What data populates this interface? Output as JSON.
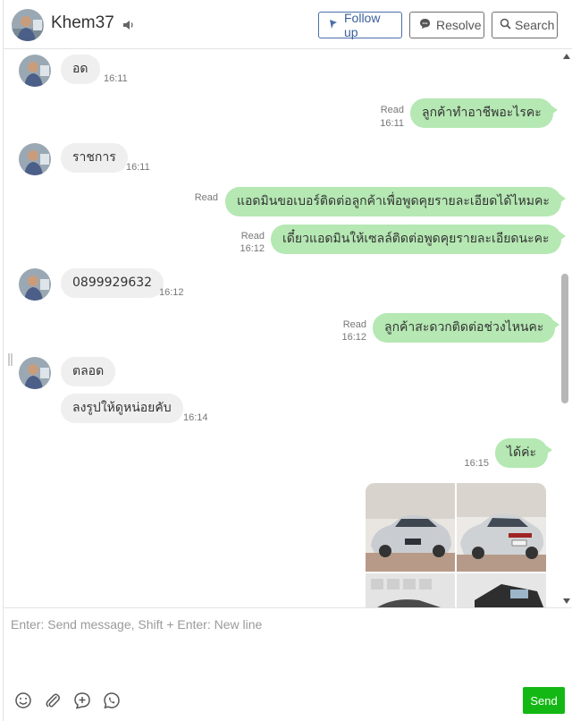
{
  "header": {
    "contact_name": "Khem37",
    "buttons": {
      "follow_up": "Follow up",
      "resolve": "Resolve",
      "search": "Search"
    }
  },
  "messages": [
    {
      "side": "in",
      "text": "อด",
      "time": "16:11"
    },
    {
      "side": "out",
      "text": "ลูกค้าทำอาชีพอะไรคะ",
      "status": "Read",
      "time": "16:11"
    },
    {
      "side": "in",
      "text": "ราชการ",
      "time": "16:11"
    },
    {
      "side": "out",
      "text": "แอดมินขอเบอร์ติดต่อลูกค้าเพื่อพูดคุยรายละเอียดได้ไหมคะ",
      "status": "Read",
      "time": ""
    },
    {
      "side": "out",
      "text": "เดี๋ยวแอดมินให้เซลล์ติดต่อพูดคุยรายละเอียดนะคะ",
      "status": "Read",
      "time": "16:12"
    },
    {
      "side": "in",
      "text": "0899929632",
      "time": "16:12"
    },
    {
      "side": "out",
      "text": "ลูกค้าสะดวกติดต่อช่วงไหนคะ",
      "status": "Read",
      "time": "16:12"
    },
    {
      "side": "in",
      "text": "ตลอด",
      "time": ""
    },
    {
      "side": "in",
      "text": "ลงรูปให้ดูหน่อยคับ",
      "time": "16:14"
    },
    {
      "side": "out",
      "text": "ได้ค่ะ",
      "status": "",
      "time": "16:15"
    },
    {
      "side": "out",
      "type": "image-grid",
      "images": [
        "car-front-photo",
        "car-rear-photo",
        "car-interior-photo",
        "car-side-photo"
      ]
    }
  ],
  "composer": {
    "placeholder": "Enter: Send message, Shift + Enter: New line",
    "send_label": "Send",
    "tools": [
      "emoji-icon",
      "attachment-icon",
      "add-reply-icon",
      "whatsapp-icon"
    ]
  },
  "colors": {
    "outgoing_bubble": "#b5e8b3",
    "incoming_bubble": "#efefef",
    "send_button": "#14b814",
    "follow_up_accent": "#3b5f9a"
  }
}
